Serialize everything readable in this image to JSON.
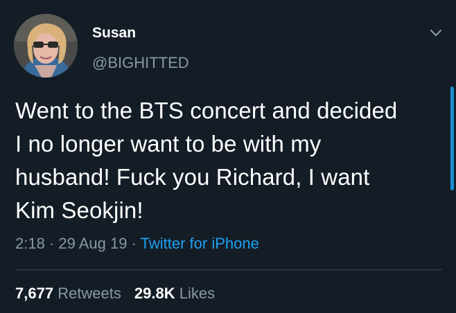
{
  "author": {
    "display_name": "Susan",
    "handle": "@BIGHITTED"
  },
  "tweet": {
    "lines": [
      "Went to the BTS concert and decided",
      "I no longer want to be with my",
      "husband! Fuck you Richard, I want",
      "Kim Seokjin!"
    ]
  },
  "meta": {
    "time": "2:18",
    "sep1": " · ",
    "date": "29 Aug 19",
    "sep2": " · ",
    "source": "Twitter for iPhone"
  },
  "stats": {
    "retweets_count": "7,677",
    "retweets_label": "Retweets",
    "likes_count": "29.8K",
    "likes_label": "Likes"
  },
  "icons": {
    "menu": "chevron-down-icon"
  },
  "colors": {
    "background": "#141d26",
    "text": "#ffffff",
    "secondary": "#8899a6",
    "link": "#1da1f2",
    "divider": "#38444d"
  }
}
